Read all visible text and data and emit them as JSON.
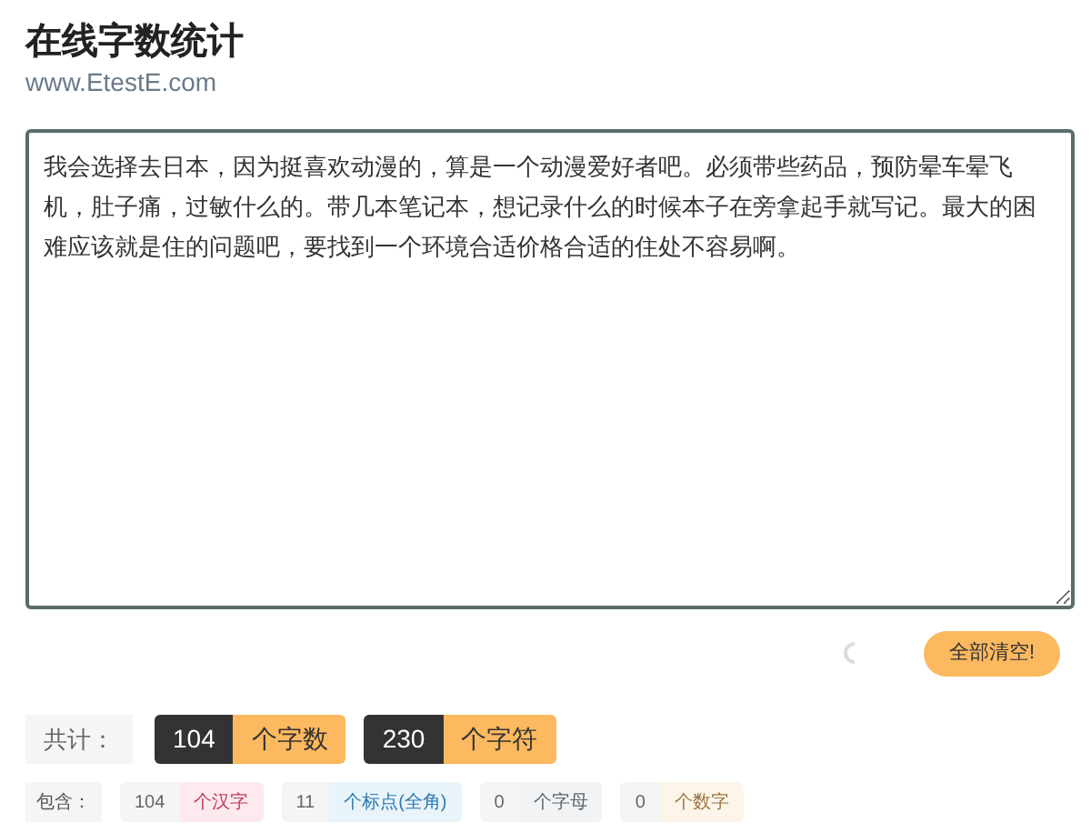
{
  "header": {
    "title": "在线字数统计",
    "subtitle": "www.EtestE.com"
  },
  "editor": {
    "value": "我会选择去日本，因为挺喜欢动漫的，算是一个动漫爱好者吧。必须带些药品，预防晕车晕飞机，肚子痛，过敏什么的。带几本笔记本，想记录什么的时候本子在旁拿起手就写记。最大的困难应该就是住的问题吧，要找到一个环境合适价格合适的住处不容易啊。"
  },
  "clear_button": "全部清空!",
  "totals": {
    "label": "共计：",
    "items": [
      {
        "count": "104",
        "unit": "个字数"
      },
      {
        "count": "230",
        "unit": "个字符"
      }
    ]
  },
  "details": {
    "label": "包含：",
    "items": [
      {
        "count": "104",
        "unit": "个汉字",
        "color": "#c0395a"
      },
      {
        "count": "11",
        "unit": "个标点(全角)",
        "color": "#2a7ab0"
      },
      {
        "count": "0",
        "unit": "个字母",
        "color": "#5a6570"
      },
      {
        "count": "0",
        "unit": "个数字",
        "color": "#9a7540"
      }
    ]
  }
}
